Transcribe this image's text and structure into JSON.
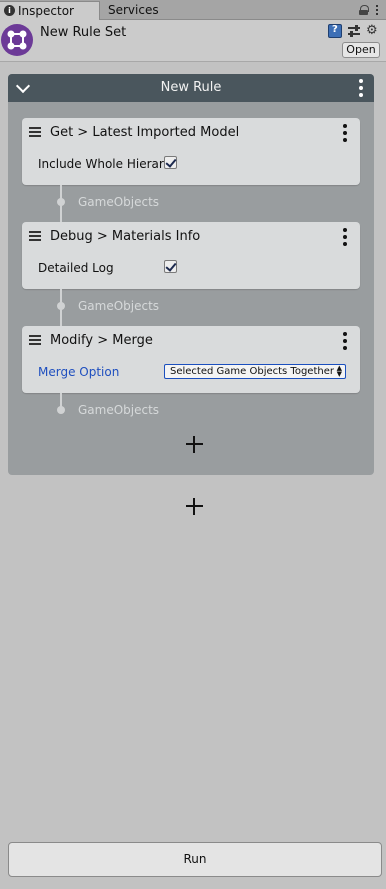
{
  "tabs": [
    {
      "label": "Inspector",
      "active": true
    },
    {
      "label": "Services",
      "active": false
    }
  ],
  "header": {
    "title": "New Rule Set",
    "open_label": "Open"
  },
  "rule": {
    "title": "New Rule",
    "steps": [
      {
        "title": "Get > Latest Imported Model",
        "field_label": "Include Whole Hierarchy",
        "checked": true
      },
      {
        "title": "Debug > Materials Info",
        "field_label": "Detailed Log",
        "checked": true
      },
      {
        "title": "Modify > Merge",
        "field_label": "Merge Option",
        "select_value": "Selected Game Objects Together"
      }
    ],
    "connector_label": "GameObjects"
  },
  "run_label": "Run",
  "colors": {
    "rule_header": "#4a565d",
    "rule_body": "#999d9f",
    "step_card": "#d9dbdc",
    "asset_icon": "#6c3a97",
    "link_label": "#1f4fbf"
  }
}
